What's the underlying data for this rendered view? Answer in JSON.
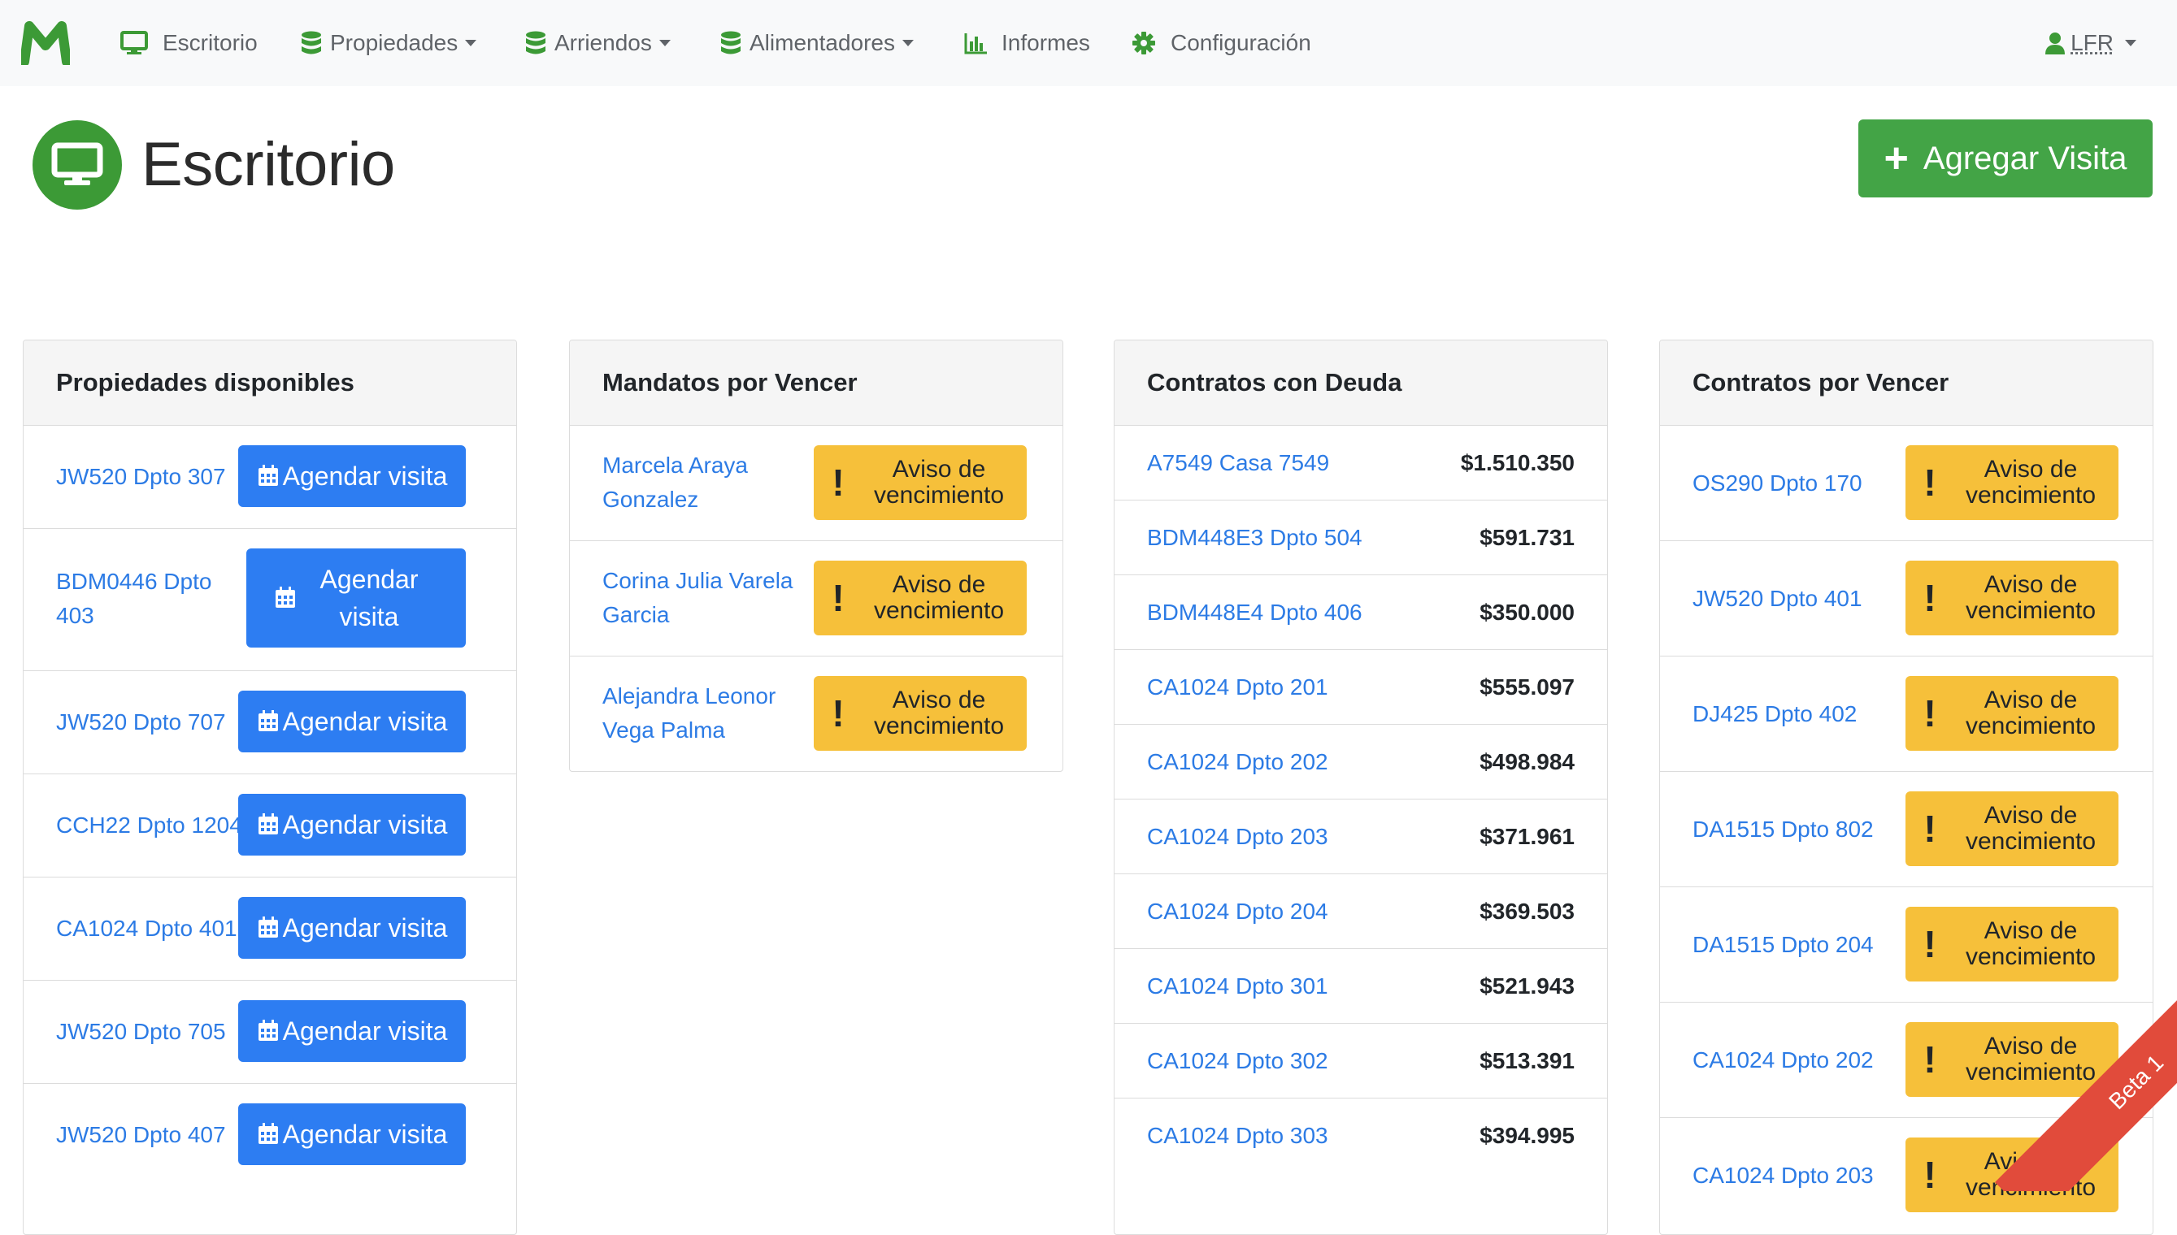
{
  "nav": {
    "items": [
      {
        "label": "Escritorio",
        "icon": "desktop-icon",
        "dropdown": false
      },
      {
        "label": "Propiedades",
        "icon": "database-icon",
        "dropdown": true
      },
      {
        "label": "Arriendos",
        "icon": "database-icon",
        "dropdown": true
      },
      {
        "label": "Alimentadores",
        "icon": "database-icon",
        "dropdown": true
      },
      {
        "label": "Informes",
        "icon": "bar-chart-icon",
        "dropdown": false
      },
      {
        "label": "Configuración",
        "icon": "gear-icon",
        "dropdown": false
      }
    ],
    "user": "LFR",
    "accent": "#3c9a36"
  },
  "header": {
    "title": "Escritorio",
    "add_visit_label": "Agregar Visita"
  },
  "propiedades": {
    "title": "Propiedades disponibles",
    "button_label": "Agendar visita",
    "items": [
      "JW520 Dpto 307",
      "BDM0446 Dpto 403",
      "JW520 Dpto 707",
      "CCH22 Dpto 1204",
      "CA1024 Dpto 401",
      "JW520 Dpto 705",
      "JW520 Dpto 407"
    ]
  },
  "mandatos": {
    "title": "Mandatos por Vencer",
    "button_label": "Aviso de vencimiento",
    "items": [
      "Marcela Araya Gonzalez",
      "Corina Julia Varela Garcia",
      "Alejandra Leonor Vega Palma"
    ]
  },
  "deuda": {
    "title": "Contratos con Deuda",
    "rows": [
      {
        "name": "A7549 Casa 7549",
        "amount": "$1.510.350"
      },
      {
        "name": "BDM448E3 Dpto 504",
        "amount": "$591.731"
      },
      {
        "name": "BDM448E4 Dpto 406",
        "amount": "$350.000"
      },
      {
        "name": "CA1024 Dpto 201",
        "amount": "$555.097"
      },
      {
        "name": "CA1024 Dpto 202",
        "amount": "$498.984"
      },
      {
        "name": "CA1024 Dpto 203",
        "amount": "$371.961"
      },
      {
        "name": "CA1024 Dpto 204",
        "amount": "$369.503"
      },
      {
        "name": "CA1024 Dpto 301",
        "amount": "$521.943"
      },
      {
        "name": "CA1024 Dpto 302",
        "amount": "$513.391"
      },
      {
        "name": "CA1024 Dpto 303",
        "amount": "$394.995"
      }
    ]
  },
  "vencer": {
    "title": "Contratos por Vencer",
    "button_label": "Aviso de vencimiento",
    "items": [
      "OS290 Dpto 170",
      "JW520 Dpto 401",
      "DJ425 Dpto 402",
      "DA1515 Dpto 802",
      "DA1515 Dpto 204",
      "CA1024 Dpto 202",
      "CA1024 Dpto 203"
    ]
  },
  "ribbon": "Beta 1",
  "colors": {
    "primary": "#2d7df2",
    "success": "#43a446",
    "warning": "#f6c03a",
    "danger": "#e14b3b",
    "link": "#2c7be5"
  }
}
